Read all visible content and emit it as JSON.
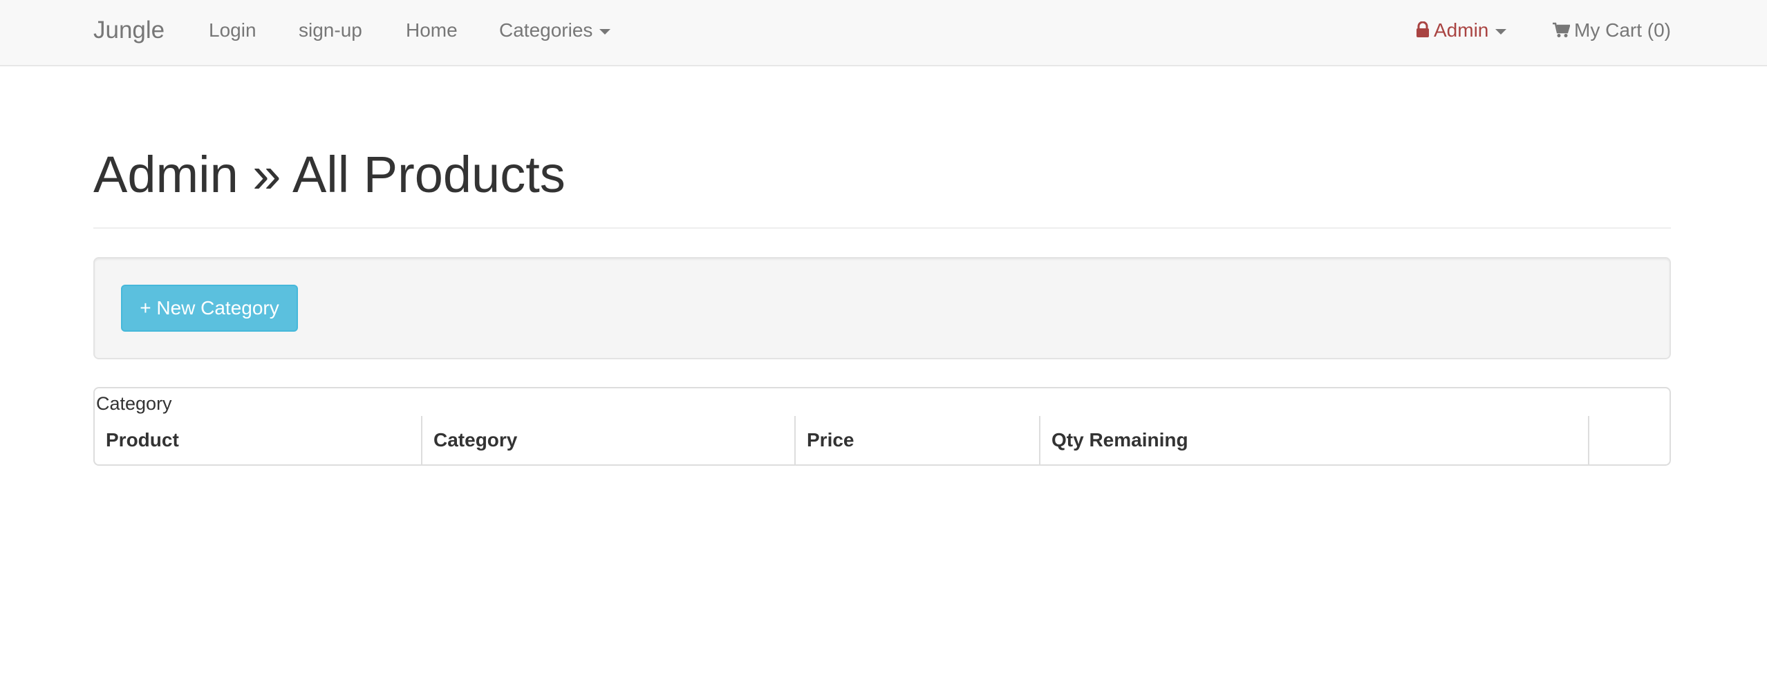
{
  "navbar": {
    "brand": "Jungle",
    "links": [
      {
        "label": "Login"
      },
      {
        "label": "sign-up"
      },
      {
        "label": "Home"
      },
      {
        "label": "Categories"
      }
    ],
    "admin": {
      "label": "Admin",
      "icon": "lock-icon",
      "color": "#a94442"
    },
    "cart": {
      "label": "My Cart (0)",
      "icon": "shopping-cart-icon"
    }
  },
  "page": {
    "title": "Admin » All Products"
  },
  "actions": {
    "new_category": "+ New Category",
    "button_color": "#5bc0de"
  },
  "table": {
    "caption": "Category",
    "headers": [
      "Product",
      "Category",
      "Price",
      "Qty Remaining",
      ""
    ]
  }
}
